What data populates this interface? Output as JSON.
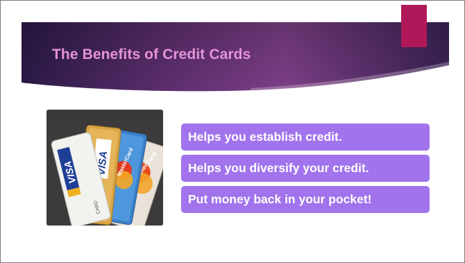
{
  "slide": {
    "title": "The Benefits of Credit Cards",
    "benefits": [
      "Helps you establish credit.",
      "Helps you diversify your credit.",
      "Put money back in your pocket!"
    ]
  },
  "image": {
    "subject": "credit-cards-photo",
    "card_texts": [
      "VISA",
      "VISA",
      "MasterCard",
      "MasterCard",
      "CARD",
      "ER"
    ]
  },
  "colors": {
    "banner_dark": "#2b1a47",
    "banner_magenta": "#7d3f87",
    "title": "#e593d7",
    "accent_block": "#b0185a",
    "benefit_box": "#a173ec",
    "benefit_text": "#ffffff",
    "slide_border": "#7a7a7a"
  }
}
